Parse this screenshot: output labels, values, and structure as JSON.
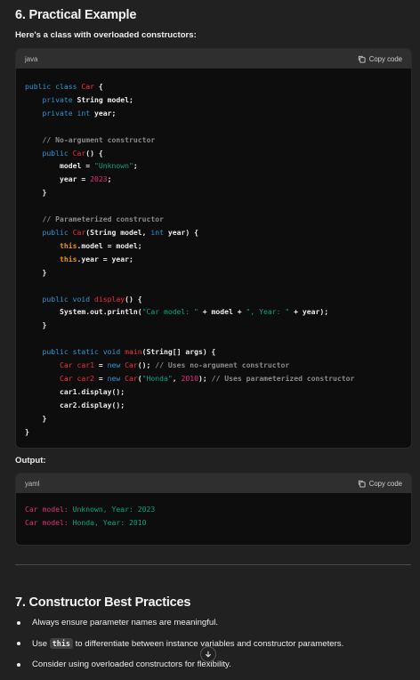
{
  "section6": {
    "title": "6. Practical Example",
    "intro": "Here's a class with overloaded constructors:"
  },
  "code1": {
    "lang": "java",
    "copy_label": "Copy code"
  },
  "output": {
    "label": "Output:",
    "lang": "yaml",
    "copy_label": "Copy code",
    "line1_key": "Car model:",
    "line1_val": "Unknown, Year: 2023",
    "line2_key": "Car model:",
    "line2_val": "Honda, Year: 2010"
  },
  "section7": {
    "title": "7. Constructor Best Practices",
    "bullet1": "Always ensure parameter names are meaningful.",
    "bullet2_pre": "Use",
    "bullet2_code": "this",
    "bullet2_post": "to differentiate between instance variables and constructor parameters.",
    "bullet3": "Consider using overloaded constructors for flexibility."
  },
  "icons": {
    "copy": "copy-icon",
    "scroll": "arrow-down-icon"
  },
  "colors": {
    "background": "#212121",
    "code_bg": "#0d0d0d",
    "code_header": "#2f2f2f",
    "keyword": "#2e95d3",
    "class_name": "#f22c3d",
    "string": "#00a67d",
    "number": "#df3079"
  }
}
